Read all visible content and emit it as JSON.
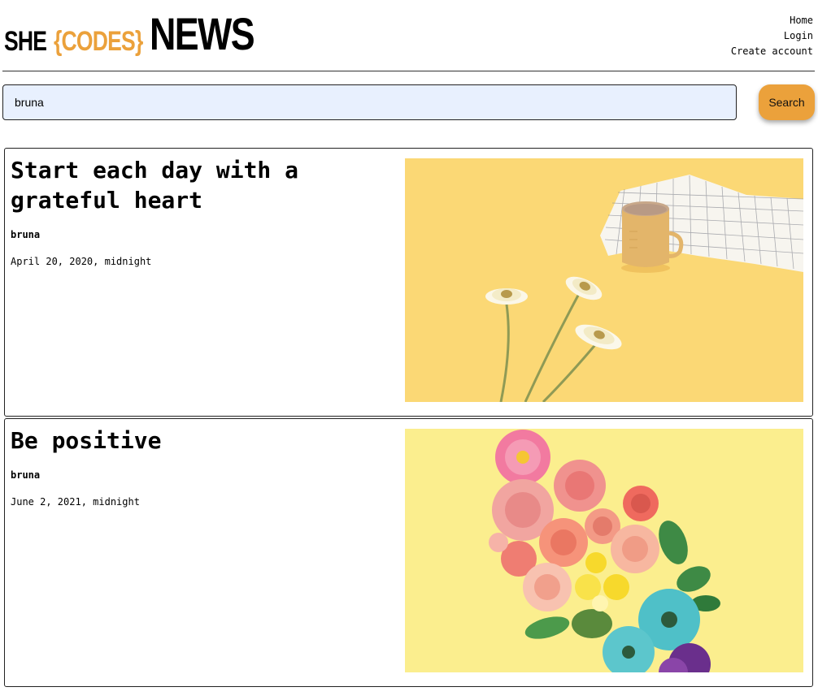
{
  "header": {
    "logo": {
      "she": "SHE",
      "codes": "{CODES}",
      "news": "NEWS"
    },
    "nav": [
      "Home",
      "Login",
      "Create account"
    ]
  },
  "search": {
    "value": "bruna",
    "button_label": "Search"
  },
  "articles": [
    {
      "title": "Start each day with a grateful heart",
      "author": "bruna",
      "date": "April 20, 2020, midnight",
      "image_description": "flowers-and-coffee-mug-on-yellow"
    },
    {
      "title": "Be positive",
      "author": "bruna",
      "date": "June 2, 2021, midnight",
      "image_description": "flower-bouquet-on-yellow"
    }
  ],
  "colors": {
    "accent": "#eba13b",
    "input_bg": "#e8f0fe",
    "image1_bg": "#fbd46b",
    "image2_bg": "#fbee8e"
  }
}
